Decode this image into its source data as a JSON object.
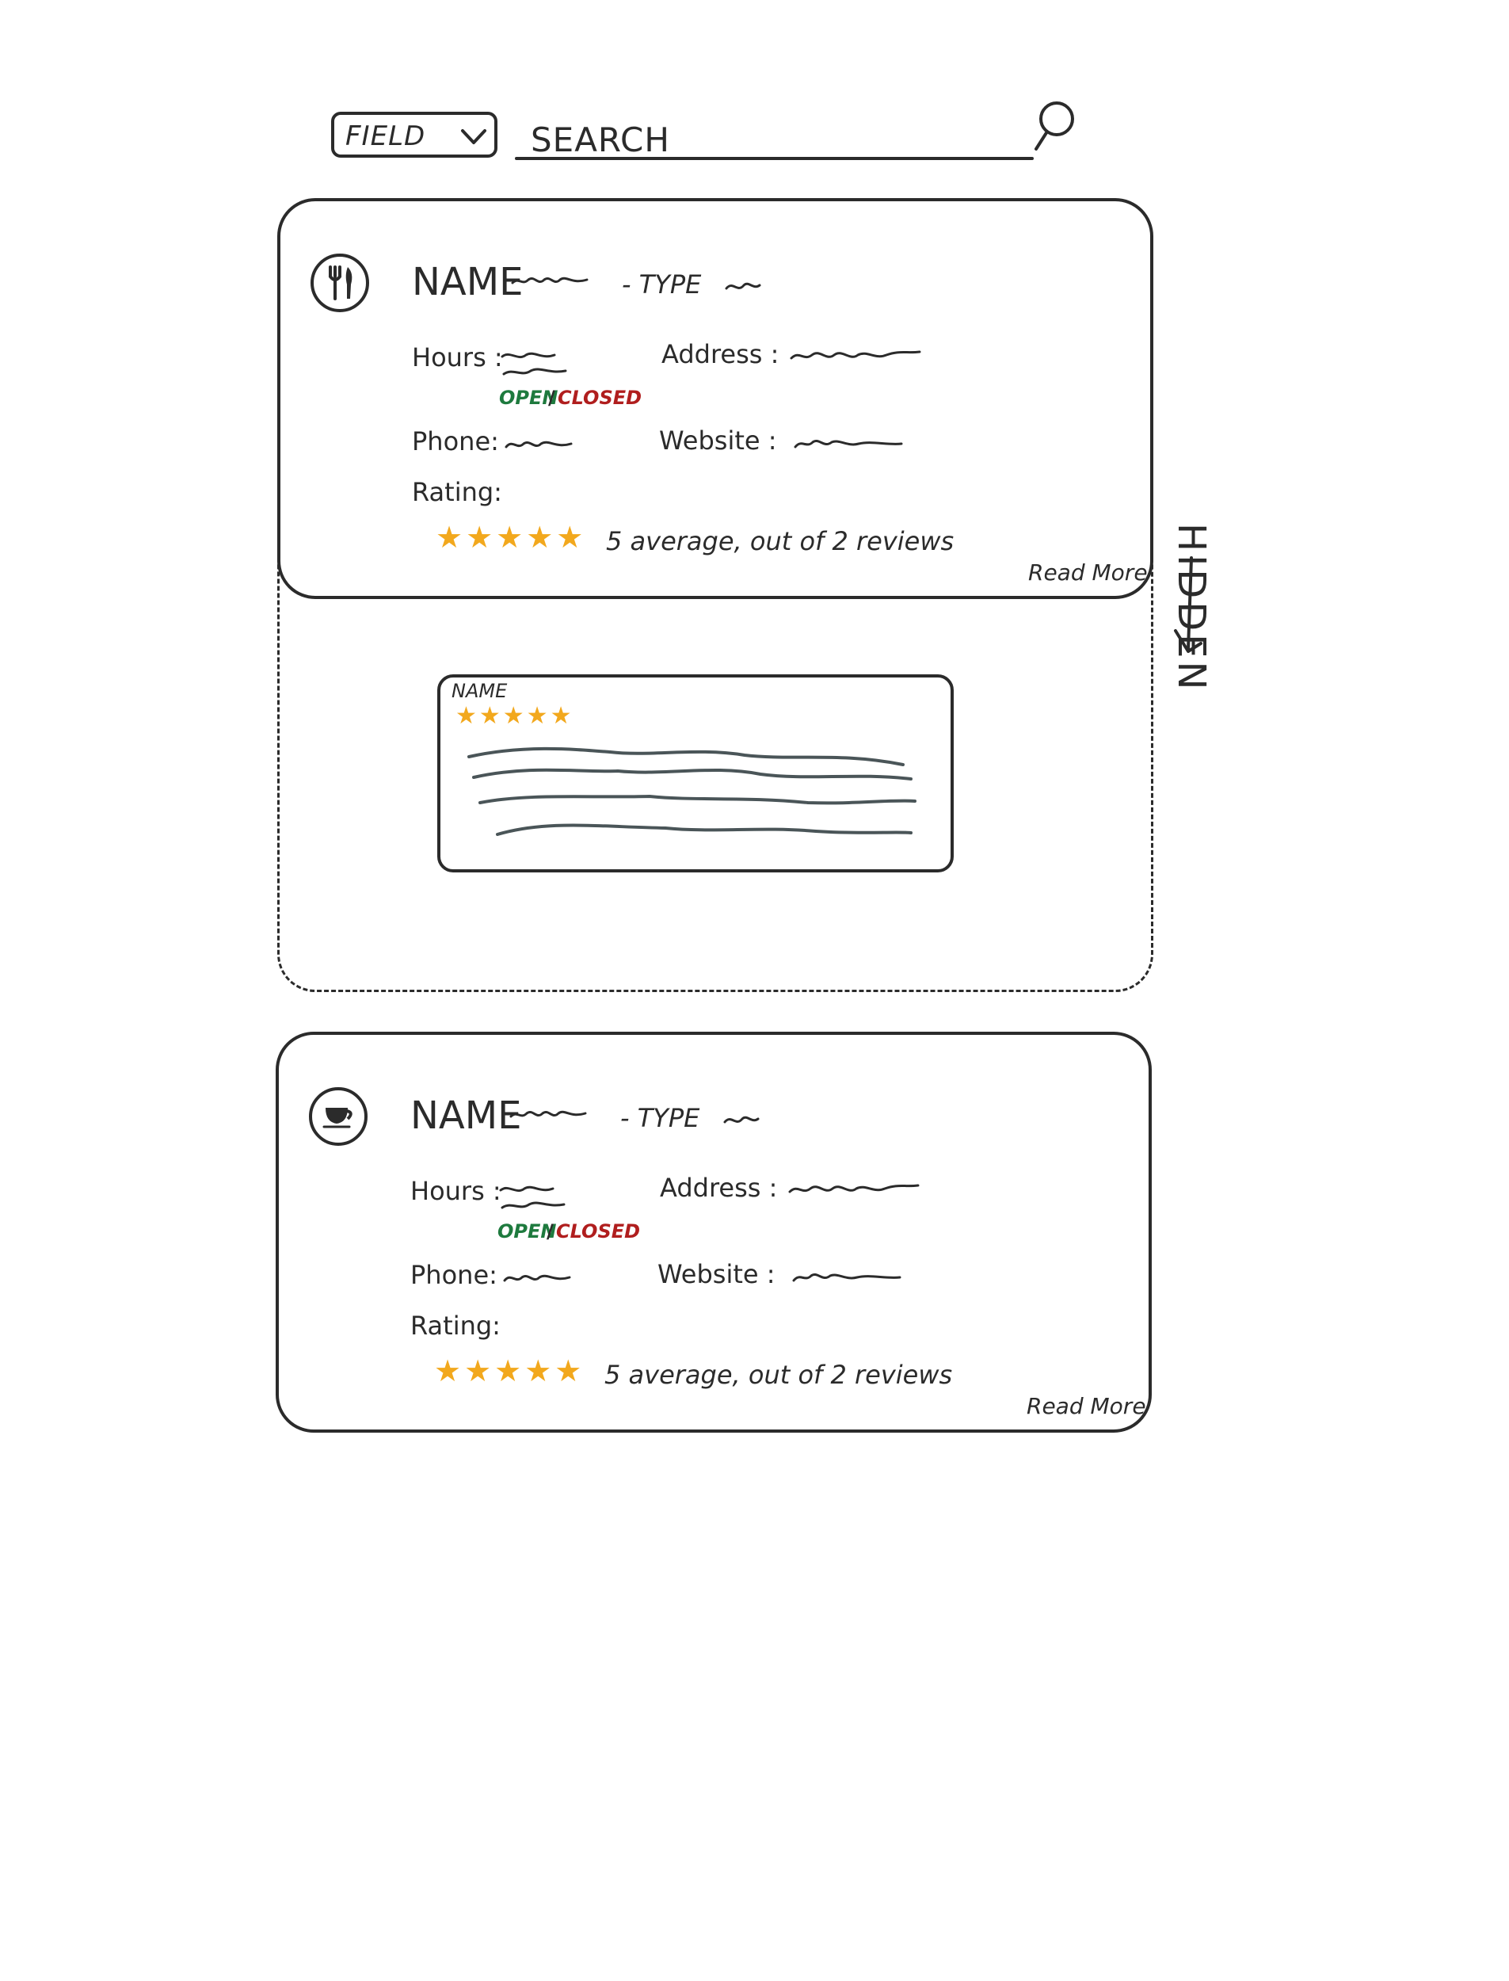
{
  "search": {
    "field_label": "FIELD",
    "placeholder": "SEARCH"
  },
  "cards": [
    {
      "icon": "fork-knife-icon",
      "name": "NAME",
      "type": "- TYPE",
      "hours_label": "Hours :",
      "open_text": "OPEN",
      "separator": "/",
      "closed_text": "CLOSED",
      "address_label": "Address :",
      "phone_label": "Phone:",
      "website_label": "Website :",
      "rating_label": "Rating:",
      "stars": "★★★★★",
      "rating_summary": "5 average, out of 2 reviews",
      "read_more": "Read More"
    },
    {
      "icon": "coffee-cup-icon",
      "name": "NAME",
      "type": "- TYPE",
      "hours_label": "Hours :",
      "open_text": "OPEN",
      "separator": "/",
      "closed_text": "CLOSED",
      "address_label": "Address :",
      "phone_label": "Phone:",
      "website_label": "Website :",
      "rating_label": "Rating:",
      "stars": "★★★★★",
      "rating_summary": "5 average, out of 2 reviews",
      "read_more": "Read More"
    }
  ],
  "hidden_section": {
    "label": "HIDDEN",
    "review": {
      "name": "NAME",
      "stars": "★★★★★"
    }
  },
  "colors": {
    "ink": "#2b2b2b",
    "star": "#f2a81d",
    "open": "#1e7a3e",
    "closed": "#b01e1e"
  }
}
